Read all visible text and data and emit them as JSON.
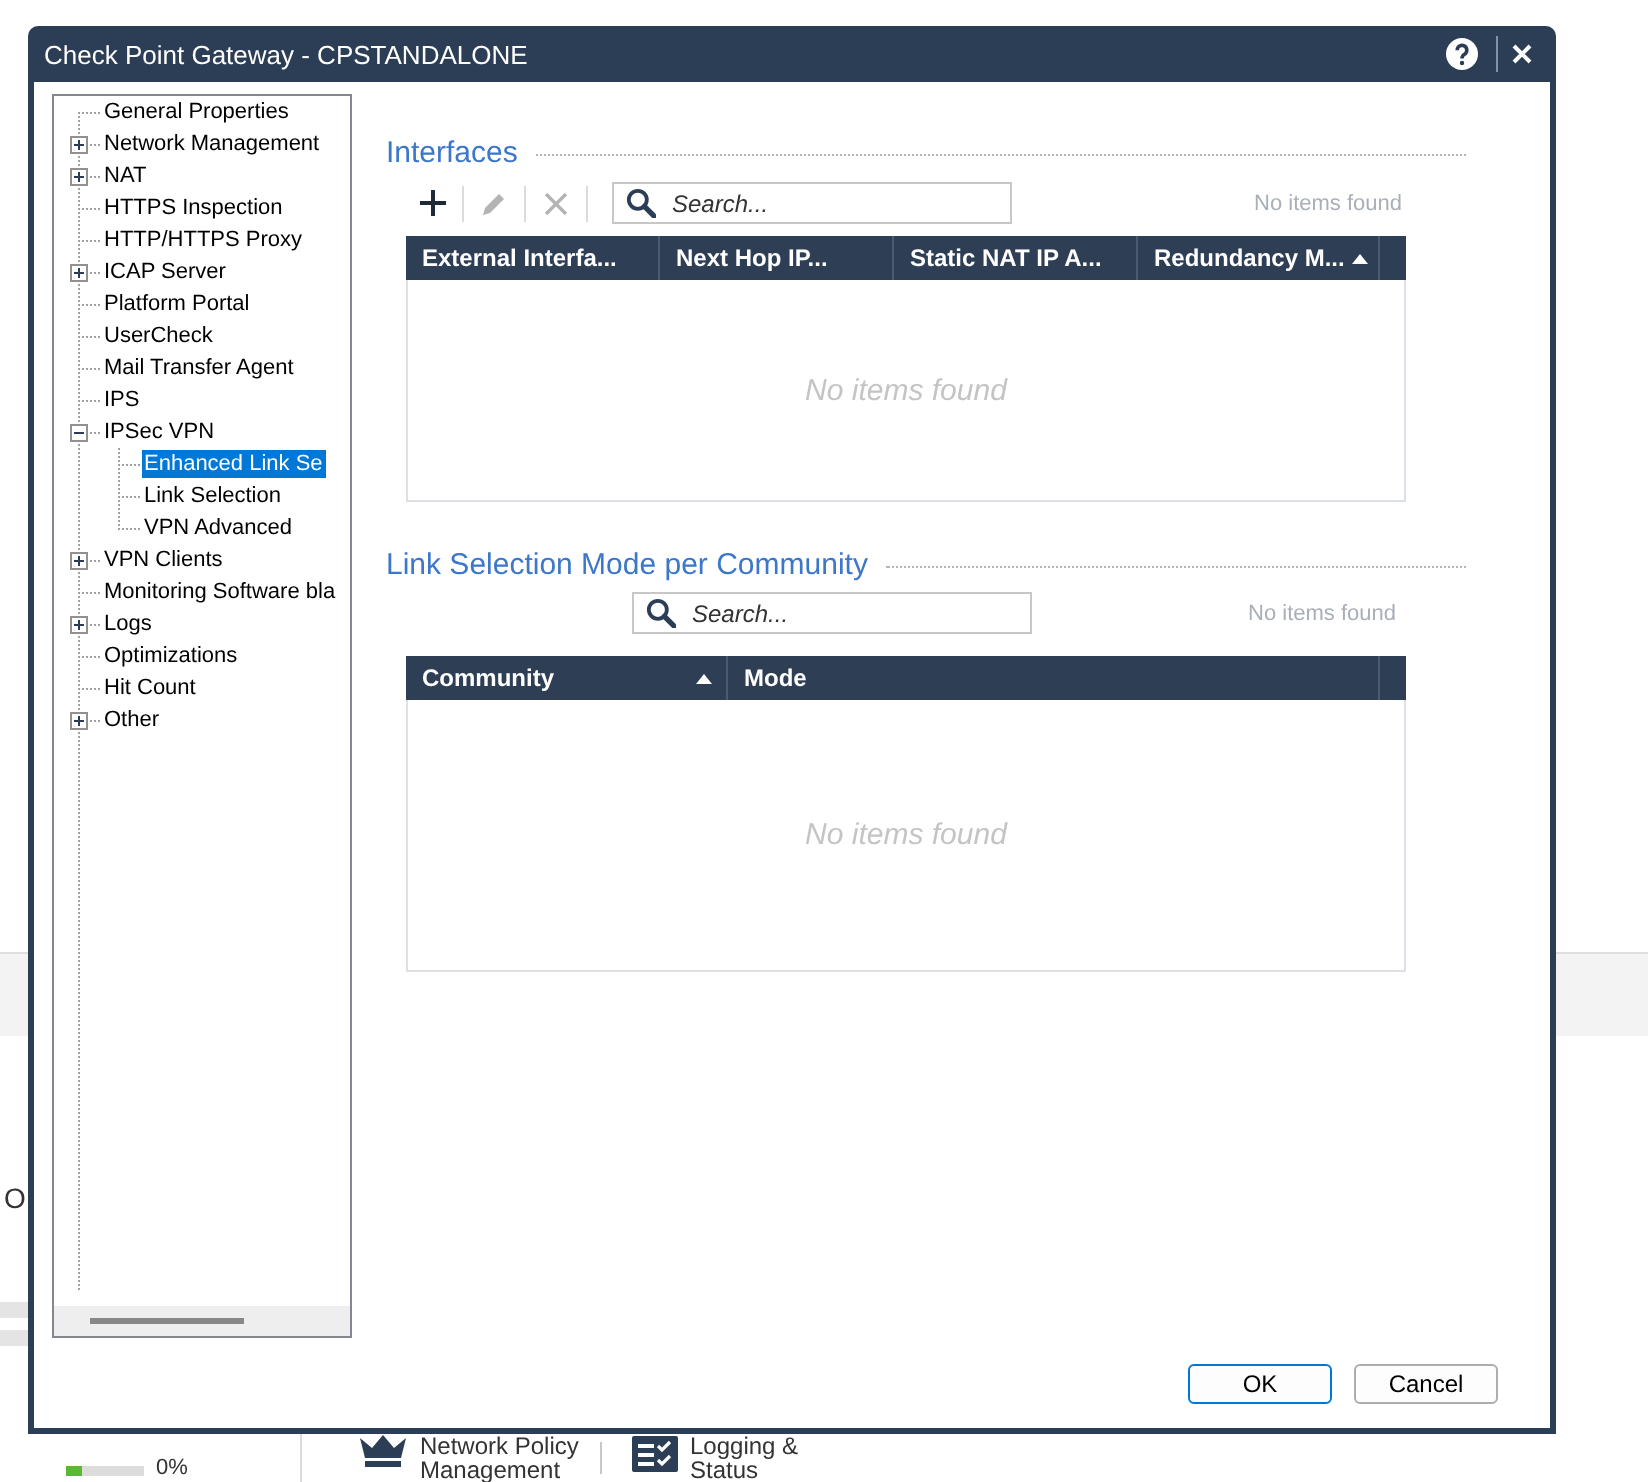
{
  "window": {
    "title": "Check Point Gateway - CPSTANDALONE"
  },
  "tree": [
    {
      "label": "General Properties",
      "selected": false
    },
    {
      "label": "Network Management",
      "expanded": false,
      "selected": false
    },
    {
      "label": "NAT",
      "expanded": false,
      "selected": false
    },
    {
      "label": "HTTPS Inspection",
      "selected": false
    },
    {
      "label": "HTTP/HTTPS Proxy",
      "selected": false
    },
    {
      "label": "ICAP Server",
      "expanded": false,
      "selected": false
    },
    {
      "label": "Platform Portal",
      "selected": false
    },
    {
      "label": "UserCheck",
      "selected": false
    },
    {
      "label": "Mail Transfer Agent",
      "selected": false
    },
    {
      "label": "IPS",
      "selected": false
    },
    {
      "label": "IPSec VPN",
      "expanded": true,
      "selected": false,
      "children": [
        {
          "label": "Enhanced Link Se",
          "selected": true
        },
        {
          "label": "Link Selection",
          "selected": false
        },
        {
          "label": "VPN Advanced",
          "selected": false
        }
      ]
    },
    {
      "label": "VPN Clients",
      "expanded": false,
      "selected": false
    },
    {
      "label": "Monitoring Software bla",
      "selected": false
    },
    {
      "label": "Logs",
      "expanded": false,
      "selected": false
    },
    {
      "label": "Optimizations",
      "selected": false
    },
    {
      "label": "Hit Count",
      "selected": false
    },
    {
      "label": "Other",
      "expanded": false,
      "selected": false
    }
  ],
  "interfaces": {
    "title": "Interfaces",
    "toolbar": [
      {
        "kind": "add",
        "disabled": false
      },
      {
        "kind": "edit",
        "disabled": true
      },
      {
        "kind": "delete",
        "disabled": true
      }
    ],
    "search": {
      "placeholder": "Search..."
    },
    "count": "No items found",
    "columns": [
      {
        "label": "External Interfa...",
        "sorted": false
      },
      {
        "label": "Next Hop IP...",
        "sorted": false
      },
      {
        "label": "Static NAT IP A...",
        "sorted": false
      },
      {
        "label": "Redundancy M...",
        "sorted": true
      }
    ],
    "empty_message": "No items found"
  },
  "link_selection": {
    "title": "Link Selection Mode per Community",
    "search": {
      "placeholder": "Search..."
    },
    "count": "No items found",
    "columns": [
      {
        "label": "Community",
        "sorted": true
      },
      {
        "label": "Mode",
        "sorted": false
      }
    ],
    "empty_message": "No items found"
  },
  "buttons": [
    {
      "label": "OK",
      "default": true
    },
    {
      "label": "Cancel",
      "default": false
    }
  ],
  "background": {
    "side_text": "O",
    "progress": {
      "level": 0.2,
      "reading": "0%"
    },
    "nav": [
      {
        "kind": "policy",
        "label": "Network Policy Management"
      },
      {
        "kind": "logs",
        "label": "Logging & Status"
      }
    ]
  }
}
